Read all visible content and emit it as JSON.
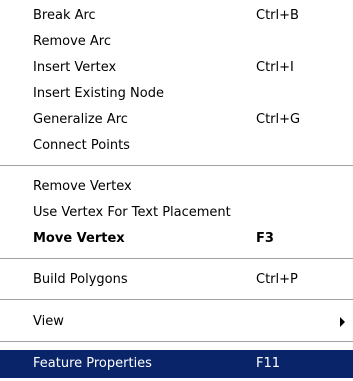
{
  "menu": {
    "items": [
      {
        "label": "Break Arc",
        "shortcut": "Ctrl+B"
      },
      {
        "label": "Remove Arc",
        "shortcut": ""
      },
      {
        "label": "Insert Vertex",
        "shortcut": "Ctrl+I"
      },
      {
        "label": "Insert Existing Node",
        "shortcut": ""
      },
      {
        "label": "Generalize Arc",
        "shortcut": "Ctrl+G"
      },
      {
        "label": "Connect Points",
        "shortcut": ""
      },
      {
        "label": "Remove Vertex",
        "shortcut": ""
      },
      {
        "label": "Use Vertex For Text Placement",
        "shortcut": ""
      },
      {
        "label": "Move Vertex",
        "shortcut": "F3"
      },
      {
        "label": "Build Polygons",
        "shortcut": "Ctrl+P"
      },
      {
        "label": "View",
        "shortcut": ""
      },
      {
        "label": "Feature Properties",
        "shortcut": "F11"
      }
    ],
    "icons": {
      "submenu_arrow": "chevron-right-icon"
    },
    "colors": {
      "highlight_bg": "#0a246a",
      "highlight_text": "#ffffff"
    }
  }
}
